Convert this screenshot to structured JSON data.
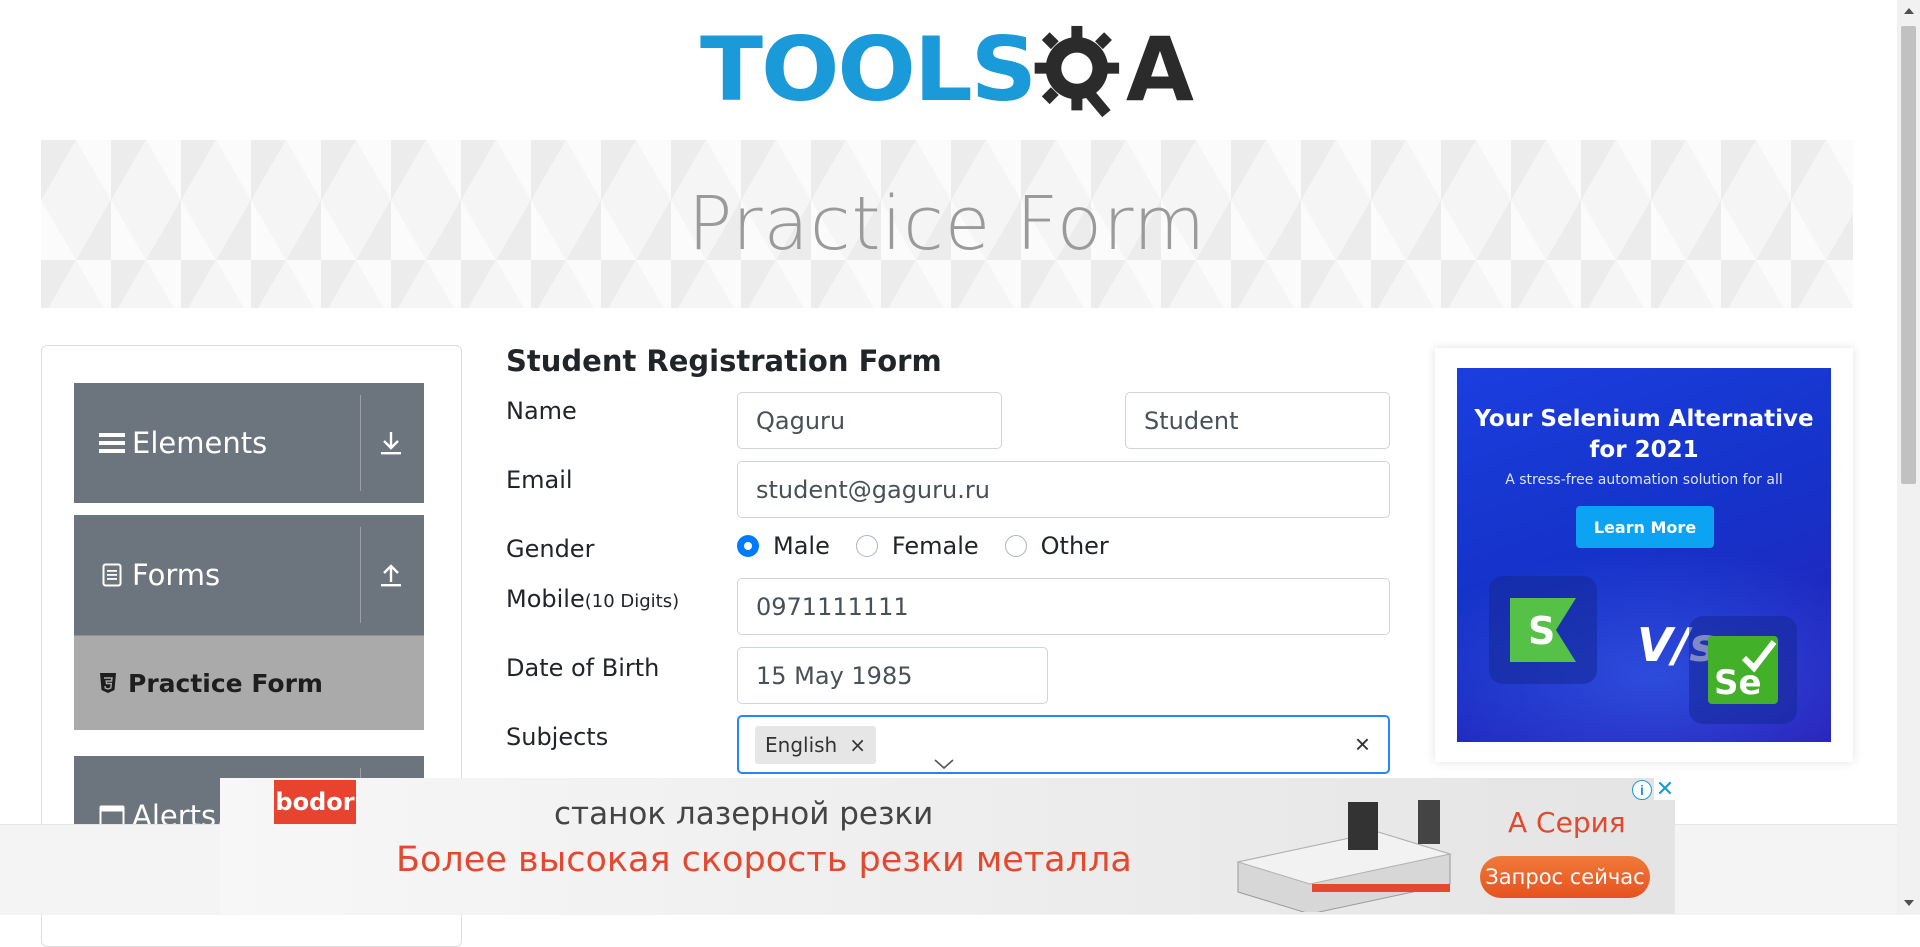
{
  "logo": {
    "text_tools": "TOOLS",
    "text_a": "A"
  },
  "banner": {
    "title": "Practice Form"
  },
  "sidebar": {
    "groups": [
      {
        "label": "Elements",
        "icon": "hamburger-icon",
        "toggle_icon": "download-arrow-icon"
      },
      {
        "label": "Forms",
        "icon": "document-icon",
        "toggle_icon": "upload-arrow-icon"
      },
      {
        "label": "Alerts,",
        "icon": "window-icon"
      }
    ],
    "active_item": {
      "label": "Practice Form",
      "icon": "html5-icon"
    }
  },
  "form": {
    "title": "Student Registration Form",
    "name_label": "Name",
    "first_name": "Qaguru",
    "last_name": "Student",
    "email_label": "Email",
    "email": "student@gaguru.ru",
    "gender_label": "Gender",
    "gender_options": [
      "Male",
      "Female",
      "Other"
    ],
    "gender_selected": "Male",
    "mobile_label": "Mobile",
    "mobile_hint": "(10 Digits)",
    "mobile": "0971111111",
    "dob_label": "Date of Birth",
    "dob": "15 May 1985",
    "subjects_label": "Subjects",
    "subjects": [
      "English"
    ],
    "remove_glyph": "×"
  },
  "side_ad": {
    "headline_1": "Your Selenium Alternative",
    "headline_2": "for 2021",
    "subtitle": "A stress-free automation solution for all",
    "button": "Learn More",
    "vs_text": "V/s",
    "tile_left": "S",
    "tile_right": "Se"
  },
  "bottom_ad": {
    "brand": "bodor",
    "line1": "станок лазерной резки",
    "line2": "Более высокая скорость резки металла",
    "series": "A Серия",
    "cta": "Запрос сейчас",
    "info_glyph": "i",
    "close_glyph": "✕"
  },
  "colors": {
    "accent_blue": "#007bff",
    "focus_border": "#2684ff",
    "sidebar_gray": "#6c757d",
    "active_gray": "#aaaaaa",
    "logo_blue": "#1a9ad8",
    "ad_red": "#e4482f"
  }
}
